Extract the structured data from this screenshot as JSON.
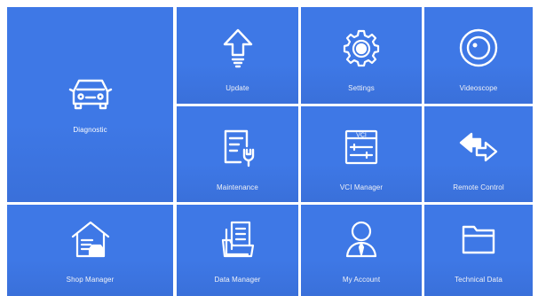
{
  "tiles": {
    "diagnostic": {
      "label": "Diagnostic",
      "icon": "car-icon"
    },
    "update": {
      "label": "Update",
      "icon": "upload-arrow-icon"
    },
    "settings": {
      "label": "Settings",
      "icon": "gear-icon"
    },
    "videoscope": {
      "label": "Videoscope",
      "icon": "camera-lens-icon"
    },
    "maintenance": {
      "label": "Maintenance",
      "icon": "clipboard-wrench-icon"
    },
    "vci_manager": {
      "label": "VCI Manager",
      "icon": "vci-device-icon",
      "icon_text": "VCI"
    },
    "remote_control": {
      "label": "Remote Control",
      "icon": "bidirectional-arrows-icon"
    },
    "shop_manager": {
      "label": "Shop Manager",
      "icon": "garage-icon"
    },
    "data_manager": {
      "label": "Data Manager",
      "icon": "documents-icon"
    },
    "my_account": {
      "label": "My Account",
      "icon": "user-icon"
    },
    "technical_data": {
      "label": "Technical Data",
      "icon": "folder-icon"
    }
  },
  "colors": {
    "tile": "#3e78e6",
    "foreground": "#ffffff",
    "background": "#ffffff"
  }
}
